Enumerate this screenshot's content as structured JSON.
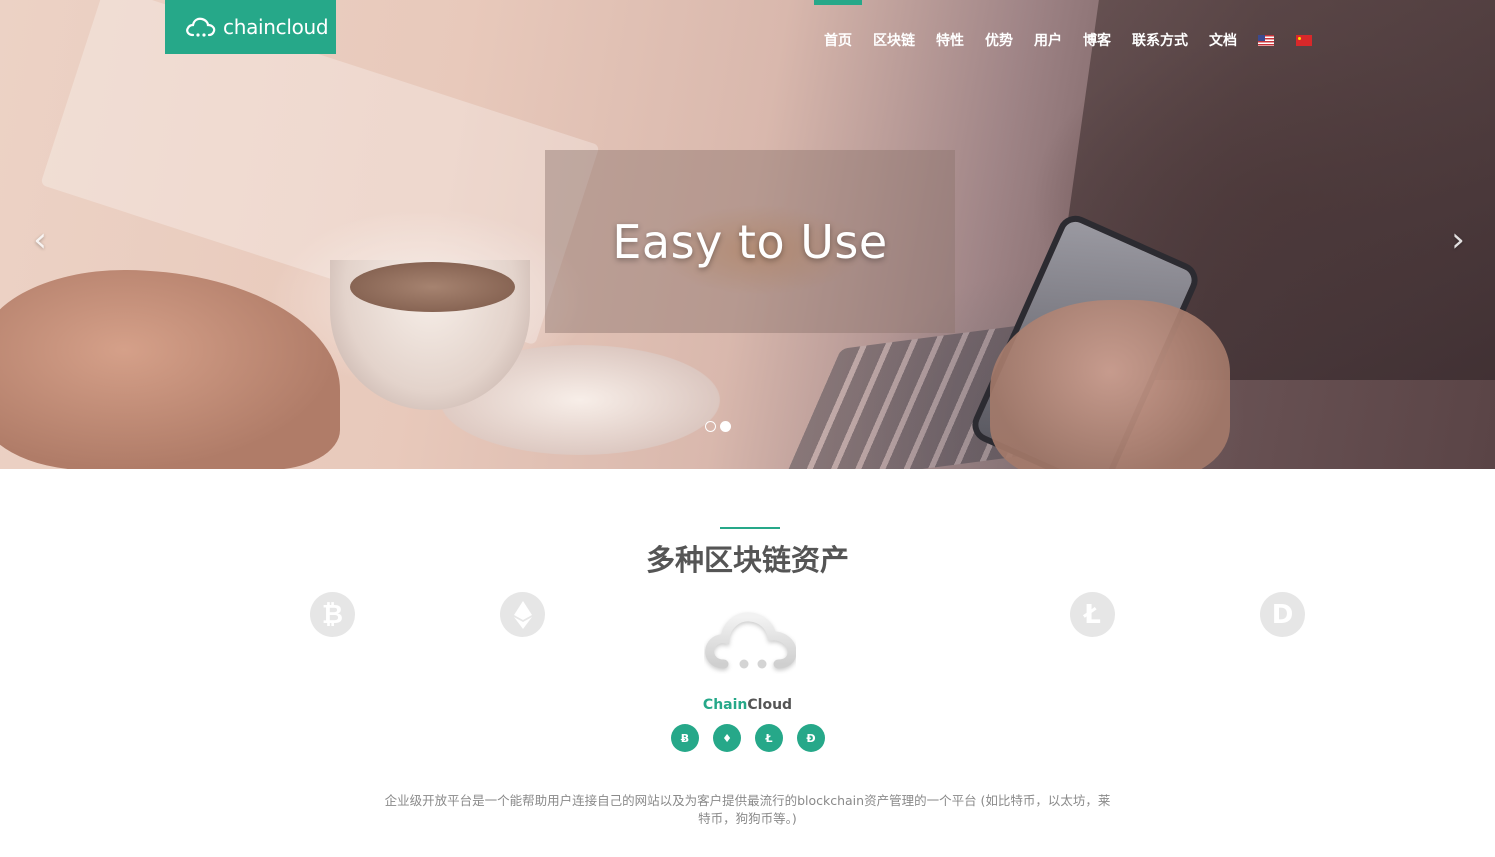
{
  "header": {
    "logo_text": "chaincloud",
    "nav": [
      {
        "label": "首页",
        "active": true
      },
      {
        "label": "区块链"
      },
      {
        "label": "特性"
      },
      {
        "label": "优势"
      },
      {
        "label": "用户"
      },
      {
        "label": "博客"
      },
      {
        "label": "联系方式"
      },
      {
        "label": "文档"
      }
    ],
    "languages": [
      "en-flag-icon",
      "cn-flag-icon"
    ]
  },
  "hero": {
    "caption": "Easy to Use",
    "prev_icon": "chevron-left-icon",
    "next_icon": "chevron-right-icon",
    "prev_glyph": "‹",
    "next_glyph": "›",
    "slides": 2,
    "active_slide": 2
  },
  "assets": {
    "title": "多种区块链资产",
    "coins": [
      {
        "name": "bitcoin-icon",
        "glyph": "₿"
      },
      {
        "name": "ethereum-icon",
        "glyph": "◆"
      },
      {
        "name": "litecoin-icon",
        "glyph": "Ł"
      },
      {
        "name": "dogecoin-icon",
        "glyph": "D"
      }
    ],
    "brand_part1": "Chain",
    "brand_part2": "Cloud",
    "mini_icons": [
      {
        "name": "bitcoin-icon",
        "glyph": "Ƀ"
      },
      {
        "name": "ethereum-icon",
        "glyph": "♦"
      },
      {
        "name": "litecoin-icon",
        "glyph": "Ł"
      },
      {
        "name": "dogecoin-icon",
        "glyph": "Ð"
      }
    ],
    "description": "企业级开放平台是一个能帮助用户连接自己的网站以及为客户提供最流行的blockchain资产管理的一个平台 (如比特币，以太坊，莱特币，狗狗币等。)"
  },
  "colors": {
    "accent": "#26a889",
    "title": "#555555",
    "muted": "#8a8a8a",
    "coin_gray": "#e6e6e6"
  }
}
